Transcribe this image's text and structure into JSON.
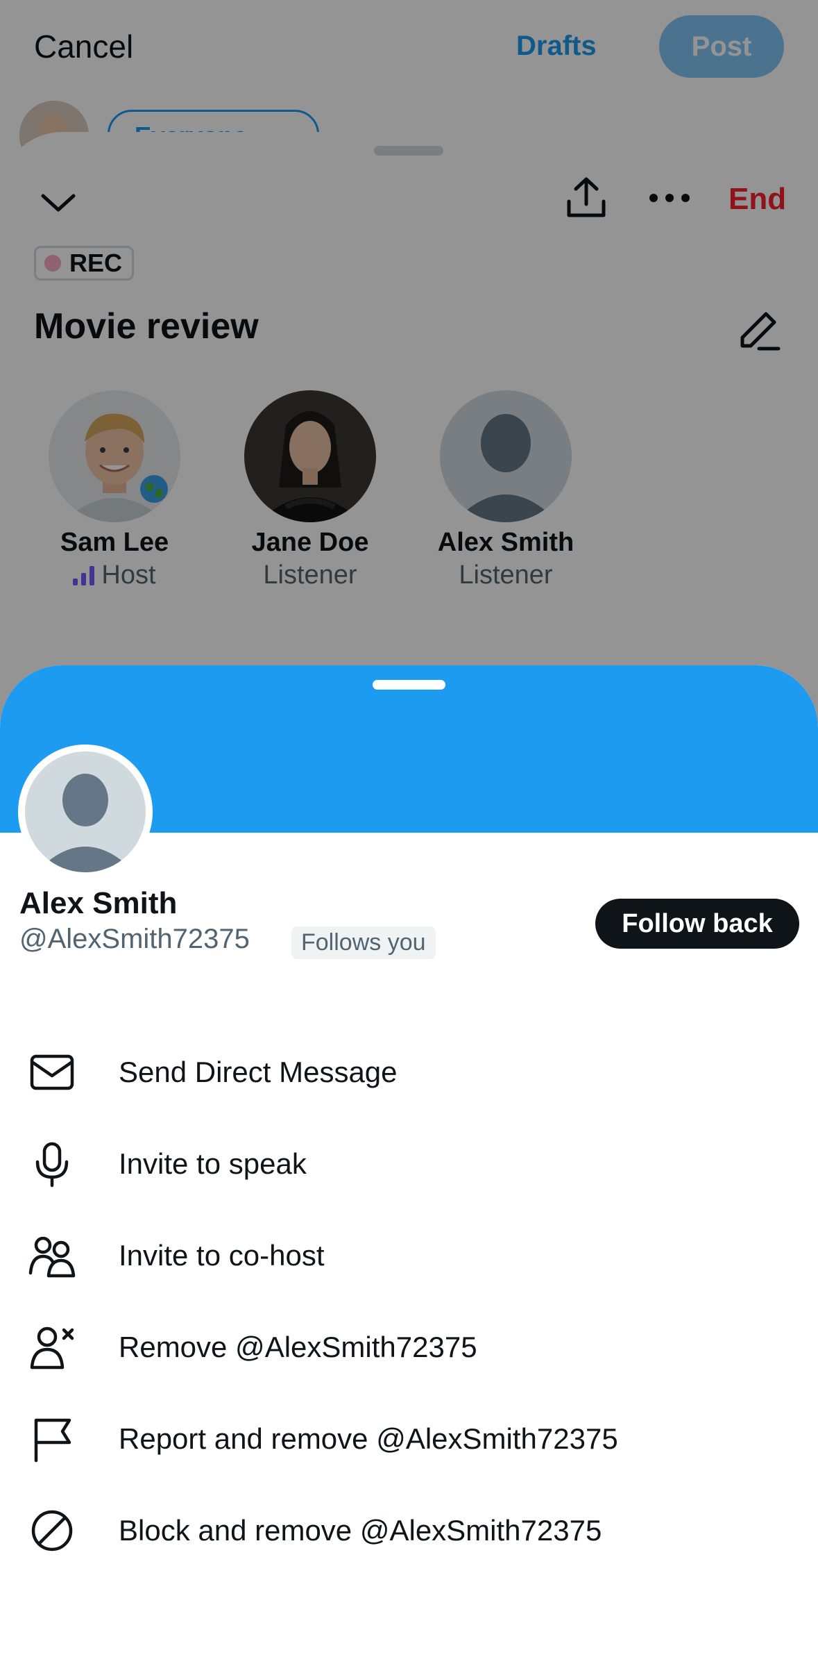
{
  "compose": {
    "cancel_label": "Cancel",
    "drafts_label": "Drafts",
    "post_label": "Post",
    "audience_label": "Everyone ~"
  },
  "space": {
    "end_label": "End",
    "rec_label": "REC",
    "title": "Movie review",
    "participants": [
      {
        "name": "Sam Lee",
        "role": "Host"
      },
      {
        "name": "Jane Doe",
        "role": "Listener"
      },
      {
        "name": "Alex Smith",
        "role": "Listener"
      }
    ]
  },
  "profile": {
    "name": "Alex Smith",
    "handle": "@AlexSmith72375",
    "follows_you": "Follows you",
    "follow_back_label": "Follow back"
  },
  "menu": {
    "items": [
      {
        "label": "Send Direct Message",
        "icon": "mail-icon"
      },
      {
        "label": "Invite to speak",
        "icon": "microphone-icon"
      },
      {
        "label": "Invite to co-host",
        "icon": "people-icon"
      },
      {
        "label": "Remove @AlexSmith72375",
        "icon": "person-remove-icon"
      },
      {
        "label": "Report and remove @AlexSmith72375",
        "icon": "flag-icon"
      },
      {
        "label": "Block and remove @AlexSmith72375",
        "icon": "block-icon"
      }
    ]
  },
  "colors": {
    "accent": "#1d9bf0",
    "end": "#f4212e",
    "host_bars": "#7856ff"
  }
}
